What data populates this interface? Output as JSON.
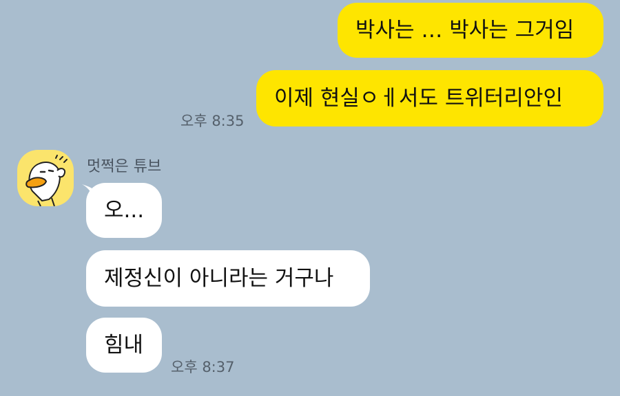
{
  "conversation": {
    "outgoing": [
      {
        "text": "박사는 … 박사는 그거임"
      },
      {
        "text": "이제 현실ㅇㅔ서도 트위터리안인"
      }
    ],
    "outgoing_time": "오후 8:35",
    "incoming_sender": "멋쩍은 튜브",
    "incoming": [
      {
        "text": "오..."
      },
      {
        "text": "제정신이 아니라는 거구나"
      },
      {
        "text": "힘내"
      }
    ],
    "incoming_time": "오후 8:37"
  },
  "colors": {
    "background": "#a9bdce",
    "outgoing_bubble": "#fee500",
    "incoming_bubble": "#ffffff"
  },
  "icons": {
    "avatar": "tube-duck-character-avatar"
  }
}
